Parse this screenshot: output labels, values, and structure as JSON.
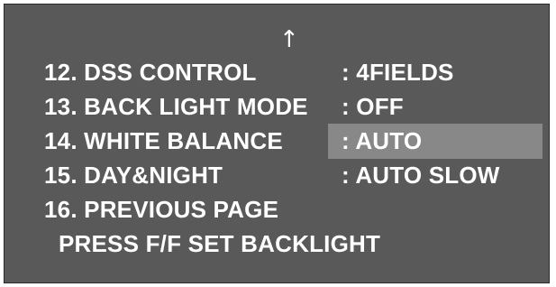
{
  "colors": {
    "screen_background": "#595959",
    "text": "#ffffff",
    "highlight": "#888888"
  },
  "menu": {
    "scroll_up_icon": "↑",
    "items": [
      {
        "label": "12. DSS CONTROL",
        "value": ": 4FIELDS",
        "selected": false
      },
      {
        "label": "13. BACK LIGHT MODE",
        "value": ": OFF",
        "selected": false
      },
      {
        "label": "14. WHITE BALANCE",
        "value": ": AUTO",
        "selected": true
      },
      {
        "label": "15. DAY&NIGHT",
        "value": ": AUTO SLOW",
        "selected": false
      },
      {
        "label": "16. PREVIOUS PAGE",
        "value": "",
        "selected": false
      }
    ],
    "footer": "PRESS F/F SET BACKLIGHT"
  }
}
